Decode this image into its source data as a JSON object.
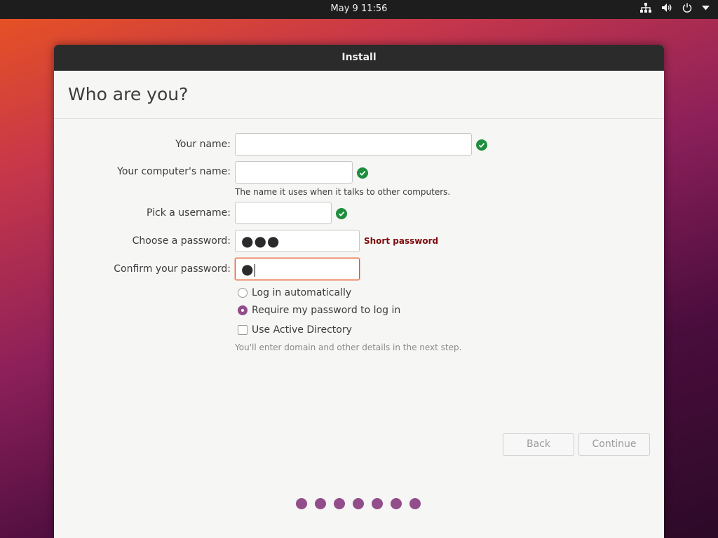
{
  "topbar": {
    "clock": "May 9  11:56",
    "icons": [
      "network-icon",
      "volume-icon",
      "power-icon",
      "menu-arrow-icon"
    ]
  },
  "window": {
    "title": "Install",
    "heading": "Who are you?"
  },
  "form": {
    "name": {
      "label": "Your name:",
      "value": ""
    },
    "computer_name": {
      "label": "Your computer's name:",
      "value": "",
      "hint": "The name it uses when it talks to other computers."
    },
    "username": {
      "label": "Pick a username:",
      "value": ""
    },
    "password": {
      "label": "Choose a password:",
      "value": "●●●",
      "strength": "Short password"
    },
    "confirm_password": {
      "label": "Confirm your password:",
      "value": "●"
    }
  },
  "login_options": {
    "auto": "Log in automatically",
    "require_password": "Require my password to log in",
    "selected": "require_password"
  },
  "active_directory": {
    "label": "Use Active Directory",
    "checked": false,
    "hint": "You'll enter domain and other details in the next step."
  },
  "buttons": {
    "back": "Back",
    "continue": "Continue"
  },
  "colors": {
    "accent": "#924d8b",
    "focus": "#e95420",
    "valid": "#1e8e3e",
    "error": "#7f0b0b"
  },
  "progress_steps": 7
}
